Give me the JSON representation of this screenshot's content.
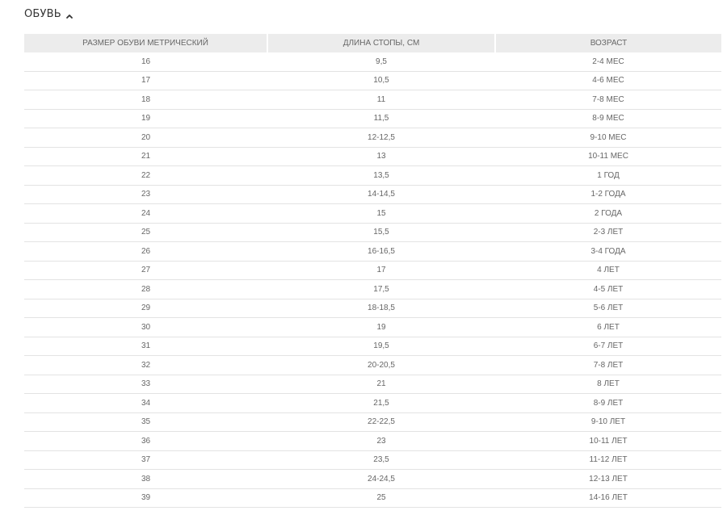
{
  "section": {
    "title": "ОБУВЬ",
    "toggle_icon": "chevron-up-icon"
  },
  "table": {
    "headers": [
      "РАЗМЕР ОБУВИ МЕТРИЧЕСКИЙ",
      "ДЛИНА СТОПЫ, СМ",
      "ВОЗРАСТ"
    ],
    "rows": [
      [
        "16",
        "9,5",
        "2-4 МЕС"
      ],
      [
        "17",
        "10,5",
        "4-6 МЕС"
      ],
      [
        "18",
        "11",
        "7-8 МЕС"
      ],
      [
        "19",
        "11,5",
        "8-9 МЕС"
      ],
      [
        "20",
        "12-12,5",
        "9-10 МЕС"
      ],
      [
        "21",
        "13",
        "10-11 МЕС"
      ],
      [
        "22",
        "13,5",
        "1 ГОД"
      ],
      [
        "23",
        "14-14,5",
        "1-2 ГОДА"
      ],
      [
        "24",
        "15",
        "2 ГОДА"
      ],
      [
        "25",
        "15,5",
        "2-3 ЛЕТ"
      ],
      [
        "26",
        "16-16,5",
        "3-4 ГОДА"
      ],
      [
        "27",
        "17",
        "4 ЛЕТ"
      ],
      [
        "28",
        "17,5",
        "4-5 ЛЕТ"
      ],
      [
        "29",
        "18-18,5",
        "5-6 ЛЕТ"
      ],
      [
        "30",
        "19",
        "6 ЛЕТ"
      ],
      [
        "31",
        "19,5",
        "6-7 ЛЕТ"
      ],
      [
        "32",
        "20-20,5",
        "7-8 ЛЕТ"
      ],
      [
        "33",
        "21",
        "8 ЛЕТ"
      ],
      [
        "34",
        "21,5",
        "8-9 ЛЕТ"
      ],
      [
        "35",
        "22-22,5",
        "9-10 ЛЕТ"
      ],
      [
        "36",
        "23",
        "10-11 ЛЕТ"
      ],
      [
        "37",
        "23,5",
        "11-12 ЛЕТ"
      ],
      [
        "38",
        "24-24,5",
        "12-13 ЛЕТ"
      ],
      [
        "39",
        "25",
        "14-16 ЛЕТ"
      ]
    ]
  }
}
